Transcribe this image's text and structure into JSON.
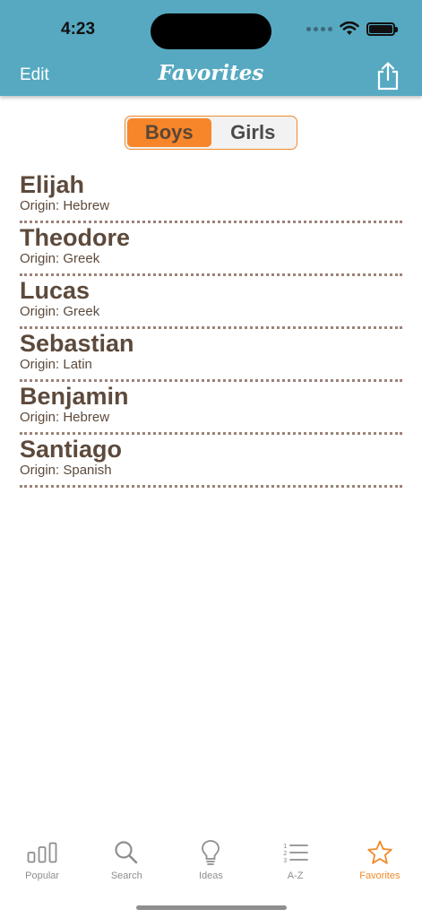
{
  "status_bar": {
    "time": "4:23"
  },
  "nav": {
    "edit_label": "Edit",
    "title": "Favorites",
    "share_icon": "share-icon"
  },
  "segment": {
    "boys": "Boys",
    "girls": "Girls",
    "selected": "Boys"
  },
  "names": [
    {
      "name": "Elijah",
      "origin": "Origin: Hebrew"
    },
    {
      "name": "Theodore",
      "origin": "Origin: Greek"
    },
    {
      "name": "Lucas",
      "origin": "Origin: Greek"
    },
    {
      "name": "Sebastian",
      "origin": "Origin: Latin"
    },
    {
      "name": "Benjamin",
      "origin": "Origin: Hebrew"
    },
    {
      "name": "Santiago",
      "origin": "Origin: Spanish"
    }
  ],
  "tabs": [
    {
      "label": "Popular",
      "icon": "bar-chart-icon"
    },
    {
      "label": "Search",
      "icon": "search-icon"
    },
    {
      "label": "Ideas",
      "icon": "lightbulb-icon"
    },
    {
      "label": "A-Z",
      "icon": "numbered-list-icon"
    },
    {
      "label": "Favorites",
      "icon": "star-icon",
      "active": true
    }
  ],
  "colors": {
    "header": "#56a9c1",
    "accent": "#f7862a",
    "text": "#5d4a3c"
  }
}
